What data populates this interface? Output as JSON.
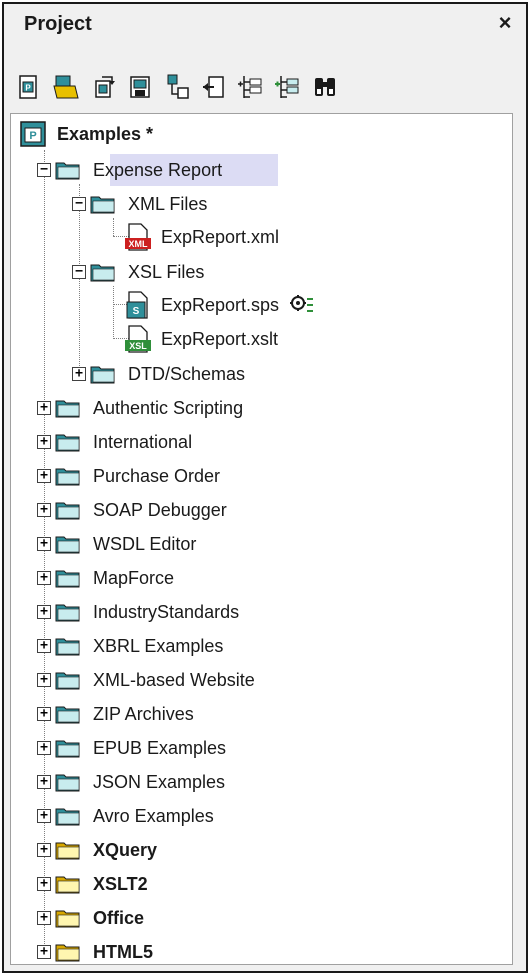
{
  "window": {
    "title": "Project",
    "close_glyph": "×"
  },
  "toolbar": {
    "buttons": [
      {
        "name": "new-project-icon"
      },
      {
        "name": "open-project-icon"
      },
      {
        "name": "reload-project-icon"
      },
      {
        "name": "save-project-icon"
      },
      {
        "name": "add-file-icon"
      },
      {
        "name": "add-active-file-icon"
      },
      {
        "name": "add-folder-icon"
      },
      {
        "name": "add-external-folder-icon"
      },
      {
        "name": "find-icon"
      }
    ]
  },
  "tree": {
    "root": {
      "label": "Examples *"
    },
    "expense_report": {
      "label": "Expense Report"
    },
    "xml_files": {
      "label": "XML Files"
    },
    "exp_xml": {
      "label": "ExpReport.xml",
      "icon_text": "XML"
    },
    "xsl_files": {
      "label": "XSL Files"
    },
    "exp_sps": {
      "label": "ExpReport.sps",
      "icon_text": "S"
    },
    "exp_xslt": {
      "label": "ExpReport.xslt",
      "icon_text": "XSL"
    },
    "dtd": {
      "label": "DTD/Schemas"
    },
    "folders": [
      {
        "label": "Authentic Scripting",
        "bold": false,
        "color": "teal"
      },
      {
        "label": "International",
        "bold": false,
        "color": "teal"
      },
      {
        "label": "Purchase Order",
        "bold": false,
        "color": "teal"
      },
      {
        "label": "SOAP Debugger",
        "bold": false,
        "color": "teal"
      },
      {
        "label": "WSDL Editor",
        "bold": false,
        "color": "teal"
      },
      {
        "label": "MapForce",
        "bold": false,
        "color": "teal"
      },
      {
        "label": "IndustryStandards",
        "bold": false,
        "color": "teal"
      },
      {
        "label": "XBRL Examples",
        "bold": false,
        "color": "teal"
      },
      {
        "label": "XML-based Website",
        "bold": false,
        "color": "teal"
      },
      {
        "label": "ZIP Archives",
        "bold": false,
        "color": "teal"
      },
      {
        "label": "EPUB Examples",
        "bold": false,
        "color": "teal"
      },
      {
        "label": "JSON Examples",
        "bold": false,
        "color": "teal"
      },
      {
        "label": "Avro Examples",
        "bold": false,
        "color": "teal"
      },
      {
        "label": "XQuery",
        "bold": true,
        "color": "yellow"
      },
      {
        "label": "XSLT2",
        "bold": true,
        "color": "yellow"
      },
      {
        "label": "Office",
        "bold": true,
        "color": "yellow"
      },
      {
        "label": "HTML5",
        "bold": true,
        "color": "yellow"
      }
    ]
  },
  "colors": {
    "teal_folder": "#2f8f9a",
    "teal_folder_light": "#c8ecee",
    "yellow_folder": "#d8a800",
    "yellow_folder_light": "#fff6b0",
    "selection": "#dcdcf4",
    "xml_red": "#cc2020",
    "xsl_green": "#2f8f3a"
  }
}
